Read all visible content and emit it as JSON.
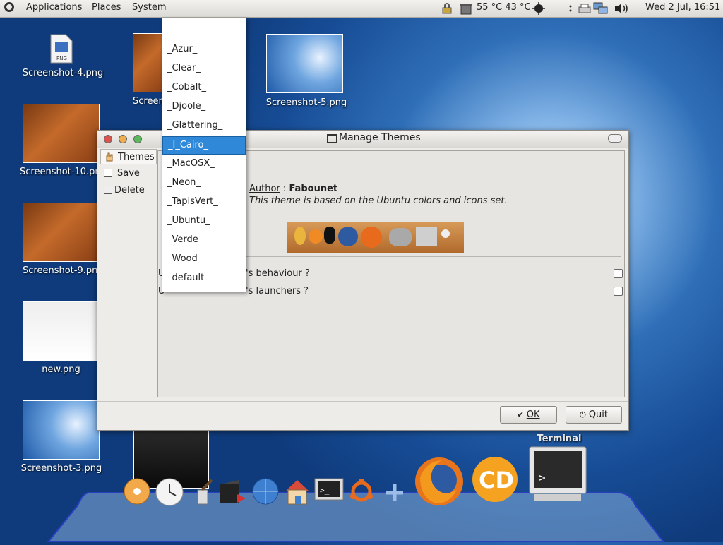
{
  "top_panel": {
    "menus": [
      "Applications",
      "Places",
      "System"
    ],
    "temps": "55 °C 43 °C",
    "clock": "Wed  2 Jul, 16:51"
  },
  "desktop_icons": [
    {
      "label": "Screenshot-4.png"
    },
    {
      "label": "Screenshot-5.png"
    },
    {
      "label": "Screenshot-10.png"
    },
    {
      "label": "Screenshot-9.png"
    },
    {
      "label": "new.png"
    },
    {
      "label": "Screenshot-3.png"
    }
  ],
  "dialog": {
    "title": "Manage Themes",
    "sidebar": [
      "Themes",
      "Save",
      "Delete"
    ],
    "theme_info": {
      "author_label": "Author",
      "author_sep": " : ",
      "author_name": "Fabounet",
      "description": "This theme is based on the Ubuntu colors and icons set."
    },
    "options": [
      "'s behaviour ?",
      "'s launchers ?"
    ],
    "buttons": {
      "ok": "OK",
      "quit": "Quit"
    }
  },
  "dropdown": {
    "items": [
      "_Azur_",
      "_Clear_",
      "_Cobalt_",
      "_Djoole_",
      "_Glattering_",
      "_I_Cairo_",
      "_MacOSX_",
      "_Neon_",
      "_TapisVert_",
      "_Ubuntu_",
      "_Verde_",
      "_Wood_",
      "_default_"
    ],
    "selected": "_I_Cairo_"
  },
  "dock": {
    "tooltip": "Terminal"
  },
  "colors": {
    "selection": "#2f89d8",
    "desktop": "#174d96"
  }
}
